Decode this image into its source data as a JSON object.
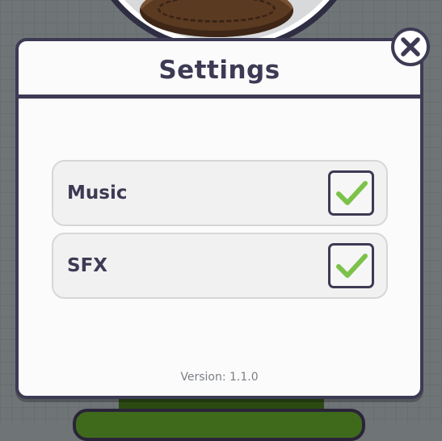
{
  "modal": {
    "title": "Settings",
    "version_text": "Version: 1.1.0"
  },
  "settings": [
    {
      "label": "Music",
      "checked": true
    },
    {
      "label": "SFX",
      "checked": true
    }
  ],
  "icons": {
    "close": "close-icon",
    "check": "checkmark-icon"
  },
  "colors": {
    "accent_dark": "#3d3a54",
    "check_green": "#7cc24a",
    "panel_bg": "#fbfbfb",
    "row_bg": "#f1f1f1",
    "backdrop": "#6f7577"
  }
}
